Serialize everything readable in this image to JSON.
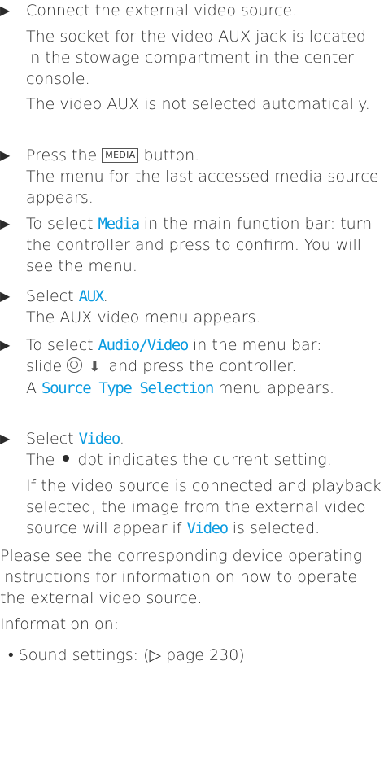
{
  "step1": {
    "arrow": "▶",
    "text": "Connect the external video source."
  },
  "p1": "The socket for the video AUX jack is located in the stowage compartment in the center console.",
  "p2": "The video AUX is not selected automatically.",
  "step2": {
    "arrow": "▶",
    "pre": "Press the",
    "key": "MEDIA",
    "post": "button.",
    "result": "The menu for the last accessed media source appears."
  },
  "step3": {
    "arrow": "▶",
    "pre": "To select",
    "code": "Media",
    "post": "in the main function bar: turn the controller and press to confirm. You will see the menu."
  },
  "step4": {
    "arrow": "▶",
    "pre": "Select",
    "code": "AUX",
    "post": ".",
    "result": "The AUX video menu appears."
  },
  "step5": {
    "arrow": "▶",
    "pre": "To select",
    "code": "Audio/Video",
    "post": "in the menu bar:",
    "line2_pre": "slide",
    "line2_post": "and press the controller.",
    "res_pre": "A",
    "res_code": "Source Type Selection",
    "res_post": "menu appears."
  },
  "step6": {
    "arrow": "▶",
    "pre": "Select",
    "code": "Video",
    "post": ".",
    "dot_pre": "The",
    "dot_post": "dot indicates the current setting."
  },
  "p3": {
    "text": "If the video source is connected and playback selected, the image from the external video source will appear if",
    "code": "Video",
    "post": "is selected."
  },
  "p4": "Please see the corresponding device operating instructions for information on how to operate the external video source.",
  "p5": "Information on:",
  "bullet": {
    "mark": "•",
    "text": "Sound settings: (▷ page 230)"
  }
}
